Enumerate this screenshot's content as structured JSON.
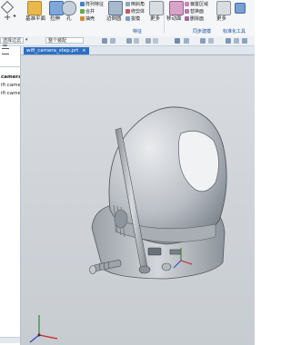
{
  "ribbon": {
    "big_buttons": [
      {
        "label": "基准平面",
        "icon": "datum-plane-icon"
      },
      {
        "label": "拉伸",
        "icon": "extrude-icon"
      },
      {
        "label": "孔",
        "icon": "hole-icon"
      },
      {
        "label": "边倒圆",
        "icon": "edge-blend-icon"
      },
      {
        "label": "更多",
        "icon": "more-icon"
      },
      {
        "label": "移动面",
        "icon": "move-face-icon"
      },
      {
        "label": "更多",
        "icon": "more-icon"
      }
    ],
    "small_buttons": [
      {
        "label": "阵列特征",
        "icon": "pattern-feature-icon"
      },
      {
        "label": "合并",
        "icon": "unite-icon"
      },
      {
        "label": "抽壳",
        "icon": "shell-icon"
      },
      {
        "label": "倒斜角",
        "icon": "chamfer-icon"
      },
      {
        "label": "修剪体",
        "icon": "trim-body-icon"
      },
      {
        "label": "拔模",
        "icon": "draft-icon"
      },
      {
        "label": "偏置区域",
        "icon": "offset-region-icon"
      },
      {
        "label": "替换面",
        "icon": "replace-face-icon"
      },
      {
        "label": "删除面",
        "icon": "delete-face-icon"
      }
    ],
    "groups": [
      "特征",
      "同步建模",
      "标准化工具"
    ]
  },
  "toolbar": {
    "filter_label": "选择过滤器",
    "assembly_scope": "整个装配"
  },
  "navigator": {
    "items": [
      "camera",
      "ifi came",
      "ifi came"
    ]
  },
  "document_tab": {
    "title": "wifi_camera_step.prt",
    "close": "×"
  }
}
